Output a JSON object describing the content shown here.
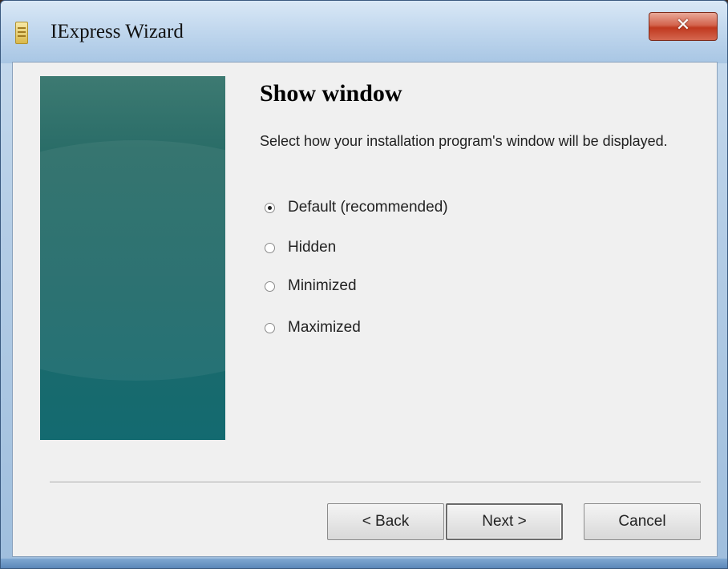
{
  "window": {
    "title": "IExpress Wizard",
    "close_label": "✕"
  },
  "page": {
    "heading": "Show window",
    "description": "Select how your installation program's window will be displayed."
  },
  "options": [
    {
      "label": "Default (recommended)",
      "selected": true
    },
    {
      "label": "Hidden",
      "selected": false
    },
    {
      "label": "Minimized",
      "selected": false
    },
    {
      "label": "Maximized",
      "selected": false
    }
  ],
  "buttons": {
    "back": "< Back",
    "next": "Next >",
    "cancel": "Cancel"
  },
  "colors": {
    "side_panel": "#1f6a6a",
    "client_bg": "#f0f0f0",
    "close_button": "#c0391f"
  }
}
